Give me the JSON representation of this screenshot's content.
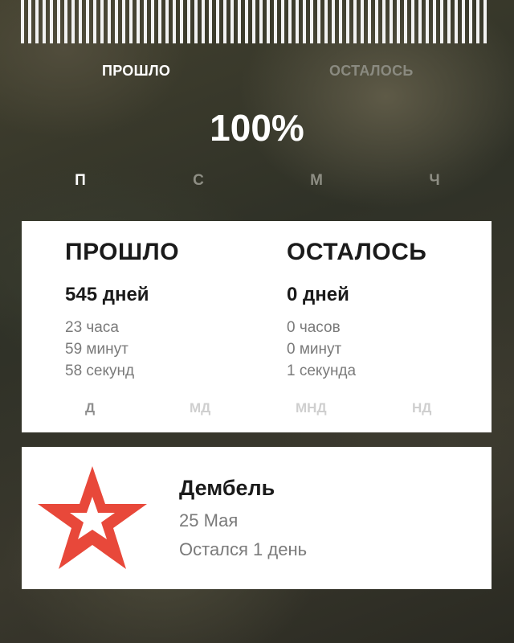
{
  "mode_tabs": {
    "passed": "ПРОШЛО",
    "remaining": "ОСТАЛОСЬ"
  },
  "progress": {
    "percent_text": "100%",
    "value": 1.0
  },
  "unit_tabs": [
    "П",
    "С",
    "М",
    "Ч"
  ],
  "timer_card": {
    "passed": {
      "title": "ПРОШЛО",
      "days": "545 дней",
      "hours": "23 часа",
      "minutes": "59 минут",
      "seconds": "58 секунд"
    },
    "remaining": {
      "title": "ОСТАЛОСЬ",
      "days": "0 дней",
      "hours": "0 часов",
      "minutes": "0 минут",
      "seconds": "1 секунда"
    },
    "tabs": [
      "Д",
      "МД",
      "МНД",
      "НД"
    ]
  },
  "event": {
    "icon": "red-star-icon",
    "title": "Дембель",
    "date": "25 Мая",
    "remaining": "Остался 1 день"
  },
  "colors": {
    "star": "#e8483a",
    "card_bg": "#ffffff",
    "text_dark": "#1a1a1a",
    "text_muted": "#7a7a7a"
  }
}
